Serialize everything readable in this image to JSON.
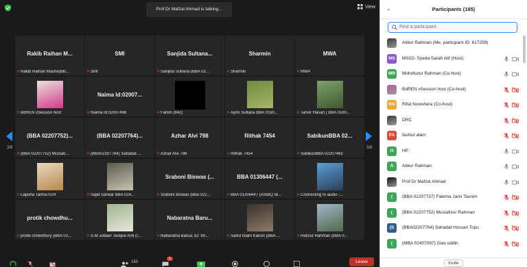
{
  "meeting": {
    "talking": "Prof Dr Mafzal Ahmad is talking...",
    "view_label": "View",
    "page_left": "3/8",
    "page_right": "3/8"
  },
  "tiles": [
    {
      "center": "Rakib  Raihan  M...",
      "label": "Rakib Raihan Mashe(BB...",
      "photo": false
    },
    {
      "center": "SMI",
      "label": "SMI",
      "photo": false
    },
    {
      "center": "Sanjida  Sultana...",
      "label": "Sanjida Sultana (BBA 02...",
      "photo": false
    },
    {
      "center": "Sharmin",
      "label": "Sharmin",
      "photo": false
    },
    {
      "center": "MWA",
      "label": "MWA",
      "photo": false
    },
    {
      "center": "",
      "label": "BdREN vSession host",
      "photo": "pink"
    },
    {
      "center": "Naima Id:02007...",
      "label": "Naima Id:02007496",
      "photo": false
    },
    {
      "center": "",
      "label": "Fahim (842)",
      "photo": "black"
    },
    {
      "center": "",
      "label": "Ayrin Sultana  BBA 0190...",
      "photo": "green"
    },
    {
      "center": "",
      "label": "Tanvir Hasan ( BBA 0180...",
      "photo": "forest"
    },
    {
      "center": "(BBA 02207752)...",
      "label": "(BBA 02207752) Mustafi...",
      "photo": false
    },
    {
      "center": "(BBA 02207764)...",
      "label": "(BBA02207764) Sahadat ...",
      "photo": false
    },
    {
      "center": "Azhar Alvi 798",
      "label": "Azhar Alvi 798",
      "photo": false
    },
    {
      "center": "Rithak 7454",
      "label": "Rithak 7454",
      "photo": false
    },
    {
      "center": "SabikunBBA  02...",
      "label": "SabikunBBA 02207463",
      "photo": false
    },
    {
      "center": "",
      "label": "Lapuha Tanha7024",
      "photo": "warm"
    },
    {
      "center": "",
      "label": "Sajid Sarwar  BBA 024...",
      "photo": "room"
    },
    {
      "center": "Sraboni Biswas  (...",
      "label": "Sraboni Biswas (Bba 022...",
      "photo": false
    },
    {
      "center": "BBA 01306447 (...",
      "label": "BBA 01306447 (ASIBQ IB...",
      "photo": false
    },
    {
      "center": "",
      "label": "Connecting to audio -...",
      "photo": "blue"
    },
    {
      "center": "protik  chowdhu...",
      "label": "protik chowdhury (BBA 02...",
      "photo": false
    },
    {
      "center": "",
      "label": "S.M Jubaer Tarique Anli (I...",
      "photo": "outdoor"
    },
    {
      "center": "Nabaratna  Baru...",
      "label": "Nabaratna Barua; ID: 90...",
      "photo": false
    },
    {
      "center": "",
      "label": "Saiful Islam Kanon (BBA ...",
      "photo": "selfie"
    },
    {
      "center": "",
      "label": "Hafizur Rahman (BBA 0...",
      "photo": "lake"
    }
  ],
  "toolbar": {
    "participants_count": "183",
    "chat_badge": "1",
    "leave_label": "Leave"
  },
  "participants": {
    "title": "Participants (185)",
    "search_placeholder": "Find a participant",
    "invite_label": "Invite",
    "items": [
      {
        "name": "Atikur Rahman (Me, participant ID: 617259)",
        "avatar": "",
        "color": "#3a3a3a",
        "photo": true,
        "mic": "none",
        "cam": "none"
      },
      {
        "name": "MSS2- Syeda Sarah Alif (Host)",
        "avatar": "MS",
        "color": "#8a58c9",
        "photo": false,
        "mic": "on",
        "cam": "on"
      },
      {
        "name": "Mohofuzur Rahman (Co-host)",
        "avatar": "MR",
        "color": "#3fa55b",
        "photo": false,
        "mic": "on",
        "cam": "on"
      },
      {
        "name": "BdREN vSession host (Co-host)",
        "avatar": "",
        "color": "#b85a9a",
        "photo": true,
        "mic": "off",
        "cam": "off"
      },
      {
        "name": "Rifat Nowshera (Co-host)",
        "avatar": "RN",
        "color": "#f2a33a",
        "photo": false,
        "mic": "off",
        "cam": "off"
      },
      {
        "name": "DRC",
        "avatar": "",
        "color": "#3a3a3a",
        "photo": true,
        "mic": "off",
        "cam": "off"
      },
      {
        "name": "fashiul alam",
        "avatar": "FA",
        "color": "#d94b3a",
        "photo": false,
        "mic": "off",
        "cam": "off"
      },
      {
        "name": "HP",
        "avatar": "H",
        "color": "#3fa55b",
        "photo": false,
        "mic": "on",
        "cam": "on"
      },
      {
        "name": "Atikur Rahman",
        "avatar": "A",
        "color": "#3fa55b",
        "photo": false,
        "mic": "on",
        "cam": "on"
      },
      {
        "name": "Prof Dr Mafzal Ahmad",
        "avatar": "",
        "color": "#111111",
        "photo": true,
        "mic": "on",
        "cam": "on"
      },
      {
        "name": "(BBA 02207737) Fatema Jarin Tasnim",
        "avatar": "(",
        "color": "#3fa55b",
        "photo": false,
        "mic": "off",
        "cam": "off"
      },
      {
        "name": "(BBA 02207752) Mustafizur Rahman",
        "avatar": "(",
        "color": "#3fa55b",
        "photo": false,
        "mic": "off",
        "cam": "off"
      },
      {
        "name": "(BBA02207764) Sahadat Hossan Topu",
        "avatar": "(S",
        "color": "#2f5f8a",
        "photo": false,
        "mic": "off",
        "cam": "off"
      },
      {
        "name": "(MBA 02407097) Gias uddin",
        "avatar": "(",
        "color": "#3fa55b",
        "photo": false,
        "mic": "off",
        "cam": "off"
      }
    ]
  }
}
